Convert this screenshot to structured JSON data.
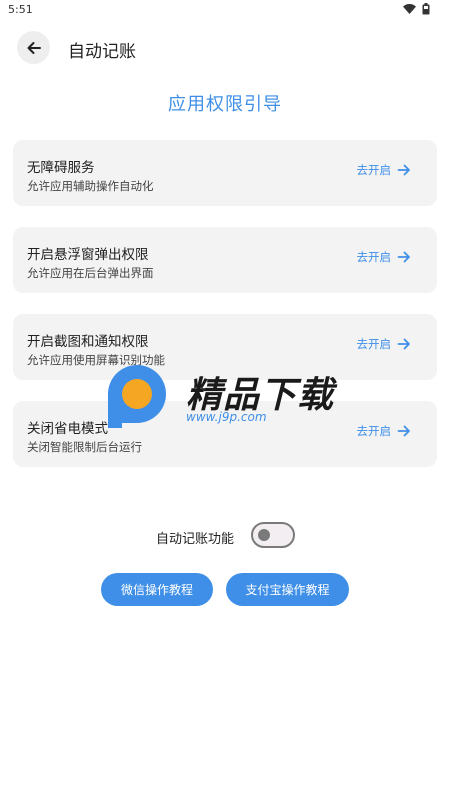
{
  "status_bar": {
    "time": "5:51"
  },
  "app_bar": {
    "title": "自动记账"
  },
  "guide": {
    "title": "应用权限引导"
  },
  "permissions": [
    {
      "title": "无障碍服务",
      "desc": "允许应用辅助操作自动化",
      "action": "去开启"
    },
    {
      "title": "开启悬浮窗弹出权限",
      "desc": "允许应用在后台弹出界面",
      "action": "去开启"
    },
    {
      "title": "开启截图和通知权限",
      "desc": "允许应用使用屏幕识别功能",
      "action": "去开启"
    },
    {
      "title": "关闭省电模式",
      "desc": "关闭智能限制后台运行",
      "action": "去开启"
    }
  ],
  "auto_bookkeeping": {
    "label": "自动记账功能",
    "enabled": false
  },
  "buttons": {
    "wechat": "微信操作教程",
    "alipay": "支付宝操作教程"
  },
  "watermark": {
    "title": "精品下载",
    "url": "www.j9p.com"
  },
  "colors": {
    "accent": "#3f8fe8",
    "card_bg": "#f3f3f3",
    "logo_orange": "#f5a623"
  }
}
